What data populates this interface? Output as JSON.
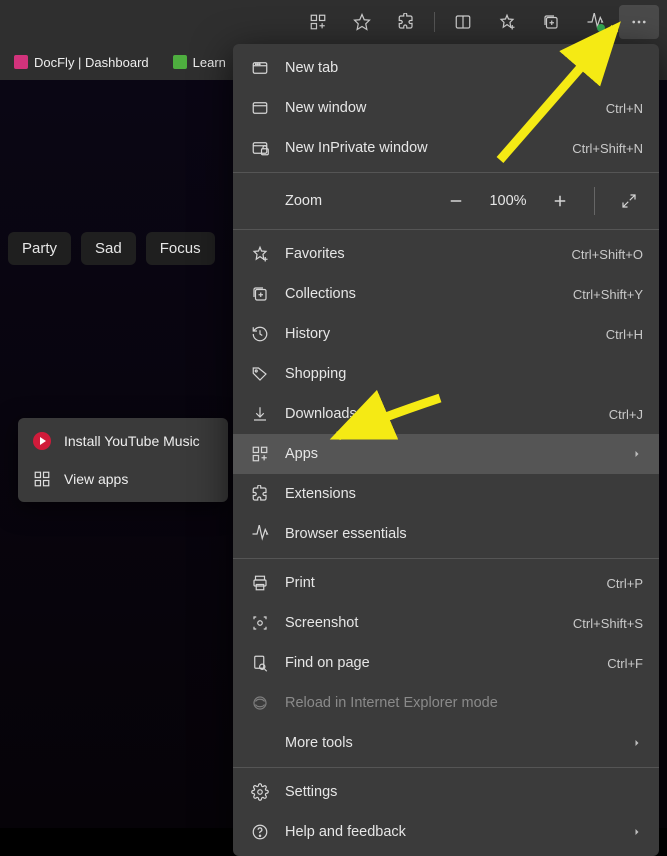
{
  "toolbar": {
    "icons": [
      "apps-icon",
      "favorite-star-icon",
      "extensions-icon",
      "split-screen-icon",
      "favorites-icon",
      "collections-icon",
      "performance-icon",
      "more-icon"
    ]
  },
  "tabs": [
    {
      "favicon": "pink",
      "title": "DocFly | Dashboard"
    },
    {
      "favicon": "green",
      "title": "Learn"
    }
  ],
  "page": {
    "chips": [
      "Party",
      "Sad",
      "Focus"
    ]
  },
  "submenu": {
    "items": [
      {
        "icon": "youtube-icon",
        "label": "Install YouTube Music"
      },
      {
        "icon": "apps-grid-icon",
        "label": "View apps"
      }
    ]
  },
  "menu": {
    "new_tab": {
      "label": "New tab",
      "shortcut": ""
    },
    "new_window": {
      "label": "New window",
      "shortcut": "Ctrl+N"
    },
    "new_inprivate": {
      "label": "New InPrivate window",
      "shortcut": "Ctrl+Shift+N"
    },
    "zoom": {
      "label": "Zoom",
      "value": "100%"
    },
    "favorites": {
      "label": "Favorites",
      "shortcut": "Ctrl+Shift+O"
    },
    "collections": {
      "label": "Collections",
      "shortcut": "Ctrl+Shift+Y"
    },
    "history": {
      "label": "History",
      "shortcut": "Ctrl+H"
    },
    "shopping": {
      "label": "Shopping",
      "shortcut": ""
    },
    "downloads": {
      "label": "Downloads",
      "shortcut": "Ctrl+J"
    },
    "apps": {
      "label": "Apps",
      "shortcut": ""
    },
    "extensions": {
      "label": "Extensions",
      "shortcut": ""
    },
    "essentials": {
      "label": "Browser essentials",
      "shortcut": ""
    },
    "print": {
      "label": "Print",
      "shortcut": "Ctrl+P"
    },
    "screenshot": {
      "label": "Screenshot",
      "shortcut": "Ctrl+Shift+S"
    },
    "find": {
      "label": "Find on page",
      "shortcut": "Ctrl+F"
    },
    "ie_mode": {
      "label": "Reload in Internet Explorer mode",
      "shortcut": ""
    },
    "more_tools": {
      "label": "More tools",
      "shortcut": ""
    },
    "settings": {
      "label": "Settings",
      "shortcut": ""
    },
    "help": {
      "label": "Help and feedback",
      "shortcut": ""
    }
  }
}
